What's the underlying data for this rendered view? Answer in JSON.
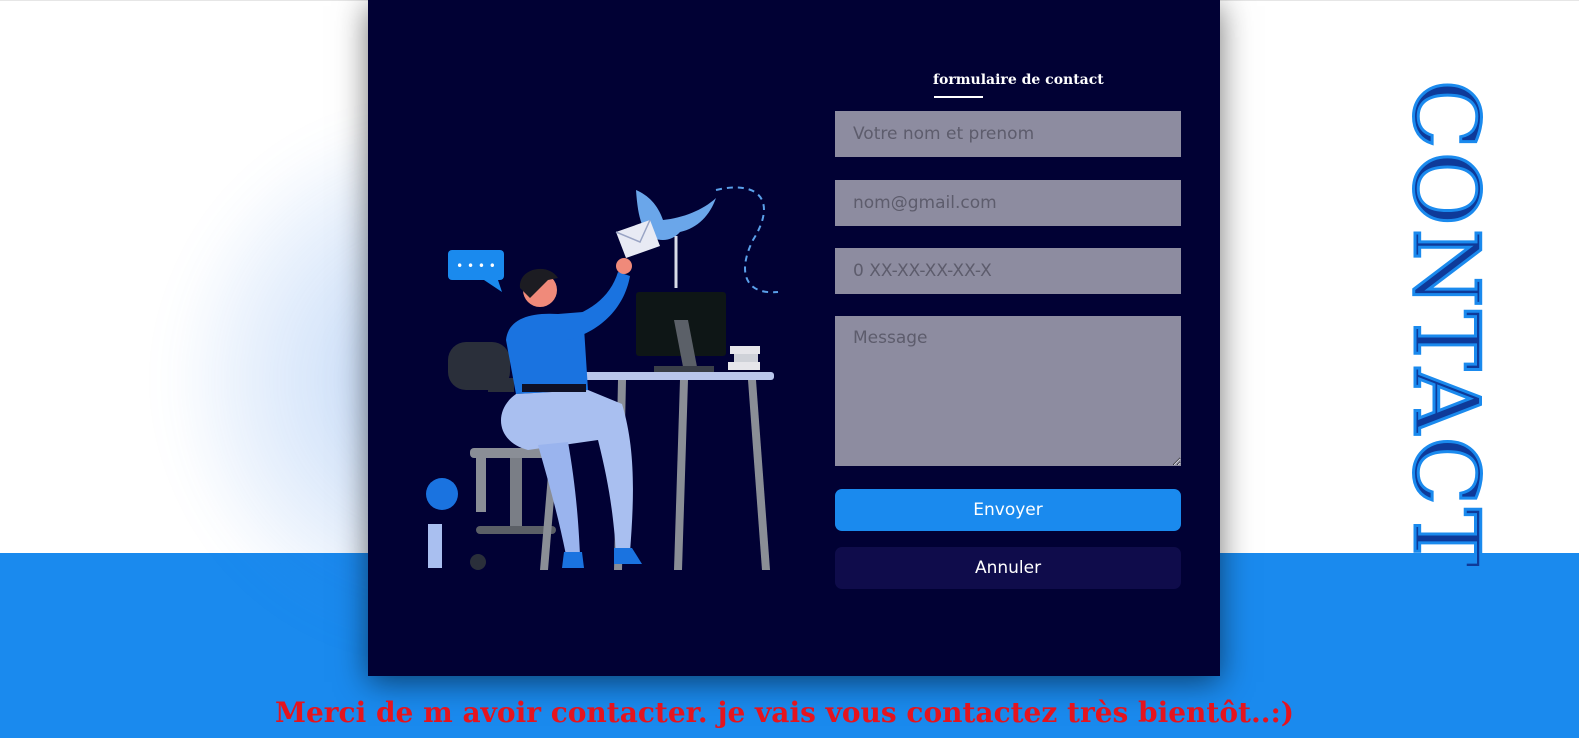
{
  "form": {
    "title": "formulaire de contact",
    "name_placeholder": "Votre nom et prenom",
    "email_placeholder": "nom@gmail.com",
    "phone_placeholder": "0 XX-XX-XX-XX-X",
    "message_placeholder": "Message",
    "send_label": "Envoyer",
    "cancel_label": "Annuler"
  },
  "side_heading": "CONTACT",
  "footer_message": "Merci de m avoir contacter. je vais vous contactez très bientôt..:)",
  "illustration": {
    "chat_bubble_text": "• • • •"
  },
  "colors": {
    "card_background": "#010134",
    "accent_blue": "#1a8aee",
    "input_background": "#8d8ca0",
    "cancel_button": "#0f0c4b",
    "footer_text": "#e5141e"
  },
  "icons": [
    "chat-bubble-icon",
    "dove-icon",
    "envelope-icon",
    "monitor-icon"
  ]
}
